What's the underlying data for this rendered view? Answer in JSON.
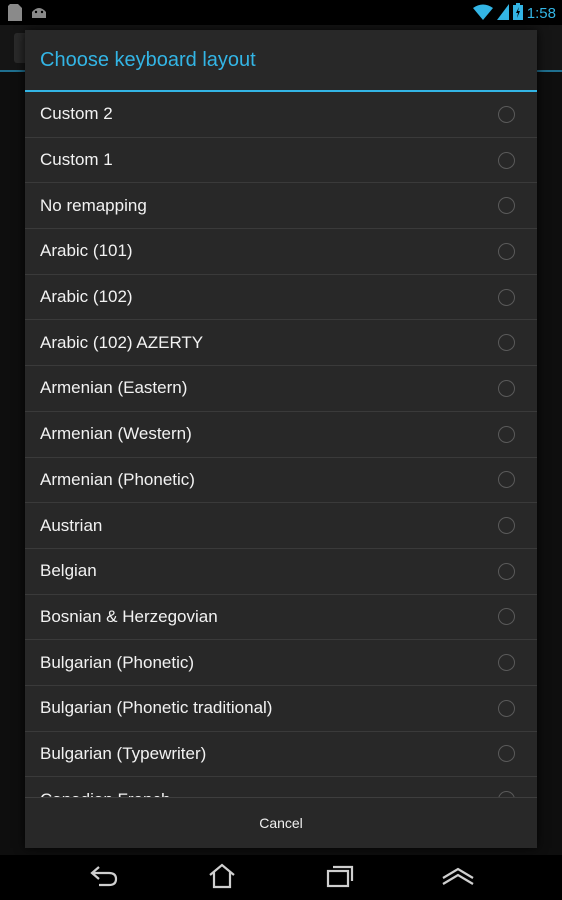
{
  "status_bar": {
    "time": "1:58",
    "icons": [
      "sd-card-icon",
      "android-icon",
      "wifi-icon",
      "signal-icon",
      "battery-charging-icon"
    ]
  },
  "dialog": {
    "title": "Choose keyboard layout",
    "items": [
      {
        "label": "Custom 2",
        "selected": false
      },
      {
        "label": "Custom 1",
        "selected": false
      },
      {
        "label": "No remapping",
        "selected": false
      },
      {
        "label": "Arabic (101)",
        "selected": false
      },
      {
        "label": "Arabic (102)",
        "selected": false
      },
      {
        "label": "Arabic (102) AZERTY",
        "selected": false
      },
      {
        "label": "Armenian (Eastern)",
        "selected": false
      },
      {
        "label": "Armenian (Western)",
        "selected": false
      },
      {
        "label": "Armenian (Phonetic)",
        "selected": false
      },
      {
        "label": "Austrian",
        "selected": false
      },
      {
        "label": "Belgian",
        "selected": false
      },
      {
        "label": "Bosnian & Herzegovian",
        "selected": false
      },
      {
        "label": "Bulgarian (Phonetic)",
        "selected": false
      },
      {
        "label": "Bulgarian (Phonetic traditional)",
        "selected": false
      },
      {
        "label": "Bulgarian (Typewriter)",
        "selected": false
      },
      {
        "label": "Canadian French",
        "selected": false
      }
    ],
    "cancel_label": "Cancel"
  },
  "nav_bar": {
    "buttons": [
      "back-icon",
      "home-icon",
      "recent-apps-icon",
      "menu-up-icon"
    ]
  },
  "colors": {
    "accent": "#33b5e5",
    "dialog_bg": "#282828",
    "divider": "#3a3a3a"
  }
}
